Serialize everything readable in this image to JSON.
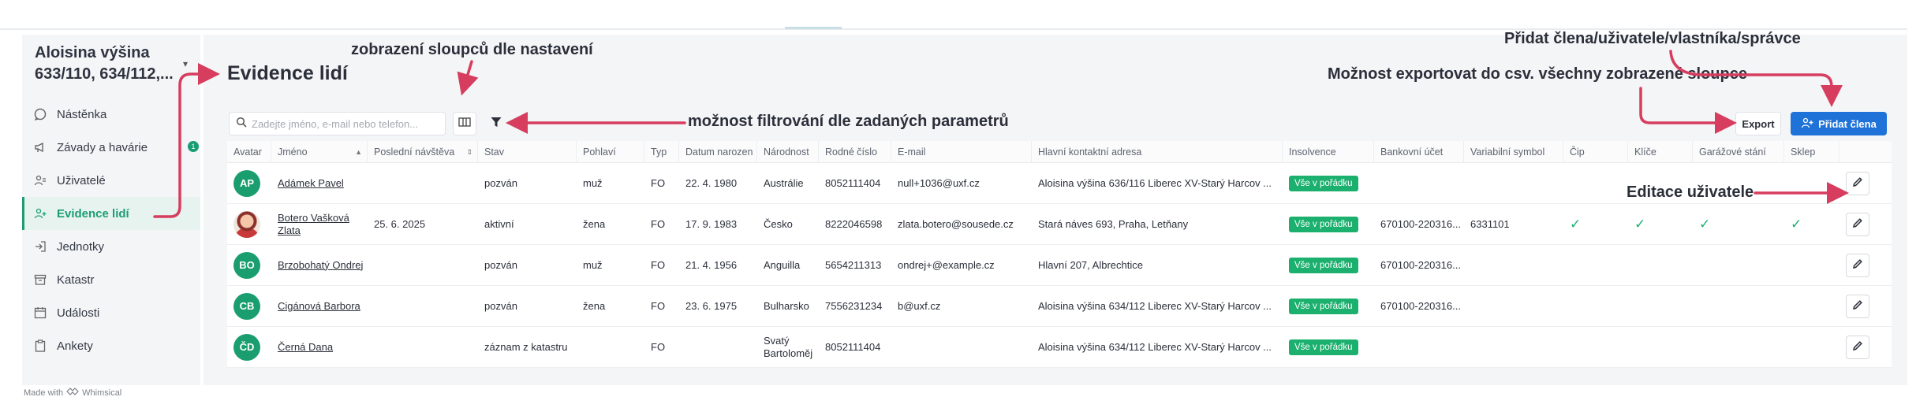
{
  "project": {
    "name": "Aloisina výšina 633/110, 634/112,...",
    "caret": "▾"
  },
  "sidebar": {
    "items": [
      {
        "label": "Nástěnka",
        "icon": "bubble-icon"
      },
      {
        "label": "Závady a havárie",
        "icon": "megaphone-icon",
        "badge": "1"
      },
      {
        "label": "Uživatelé",
        "icon": "users-icon"
      },
      {
        "label": "Evidence lidí",
        "icon": "person-add-icon",
        "active": true
      },
      {
        "label": "Jednotky",
        "icon": "door-enter-icon"
      },
      {
        "label": "Katastr",
        "icon": "archive-icon"
      },
      {
        "label": "Události",
        "icon": "calendar-icon"
      },
      {
        "label": "Ankety",
        "icon": "clipboard-icon"
      }
    ]
  },
  "main": {
    "title": "Evidence lidí",
    "search_placeholder": "Zadejte jméno, e-mail nebo telefon...",
    "export_label": "Export",
    "add_label": "Přidat člena"
  },
  "table": {
    "columns": [
      "Avatar",
      "Jméno",
      "Poslední návštěva",
      "Stav",
      "Pohlaví",
      "Typ",
      "Datum narozen",
      "Národnost",
      "Rodné číslo",
      "E-mail",
      "Hlavní kontaktní adresa",
      "Insolvence",
      "Bankovní účet",
      "Variabilní symbol",
      "Čip",
      "Klíče",
      "Garážové stání",
      "Sklep",
      ""
    ],
    "rows": [
      {
        "initials": "AP",
        "name": "Adámek Pavel",
        "last_visit": "",
        "status": "pozván",
        "gender": "muž",
        "type": "FO",
        "birth": "22. 4. 1980",
        "nationality": "Austrálie",
        "rc": "8052111404",
        "email": "null+1036@uxf.cz",
        "address": "Aloisina výšina 636/116 Liberec XV-Starý Harcov ...",
        "insolvency": "Vše v pořádku",
        "bank": "",
        "vs": "",
        "chip": "",
        "keys": "",
        "garage": "",
        "cellar": ""
      },
      {
        "initials": "",
        "photo": true,
        "name": "Botero Vašková Zlata",
        "last_visit": "25. 6. 2025",
        "status": "aktivní",
        "gender": "žena",
        "type": "FO",
        "birth": "17. 9. 1983",
        "nationality": "Česko",
        "rc": "8222046598",
        "email": "zlata.botero@sousede.cz",
        "address": "Stará náves 693, Praha, Letňany",
        "insolvency": "Vše v pořádku",
        "bank": "670100-220316...",
        "vs": "6331101",
        "chip": "✓",
        "keys": "✓",
        "garage": "✓",
        "cellar": "✓"
      },
      {
        "initials": "BO",
        "name": "Brzobohatý Ondrej",
        "last_visit": "",
        "status": "pozván",
        "gender": "muž",
        "type": "FO",
        "birth": "21. 4. 1956",
        "nationality": "Anguilla",
        "rc": "5654211313",
        "email": "ondrej+@example.cz",
        "address": "Hlavní 207, Albrechtice",
        "insolvency": "Vše v pořádku",
        "bank": "670100-220316...",
        "vs": "",
        "chip": "",
        "keys": "",
        "garage": "",
        "cellar": ""
      },
      {
        "initials": "CB",
        "name": "Cigánová Barbora",
        "last_visit": "",
        "status": "pozván",
        "gender": "žena",
        "type": "FO",
        "birth": "23. 6. 1975",
        "nationality": "Bulharsko",
        "rc": "7556231234",
        "email": "b@uxf.cz",
        "address": "Aloisina výšina 634/112 Liberec XV-Starý Harcov ...",
        "insolvency": "Vše v pořádku",
        "bank": "670100-220316...",
        "vs": "",
        "chip": "",
        "keys": "",
        "garage": "",
        "cellar": ""
      },
      {
        "initials": "ČD",
        "name": "Černá Dana",
        "last_visit": "",
        "status": "záznam z katastru",
        "gender": "",
        "type": "FO",
        "birth": "",
        "nationality": "Svatý Bartoloměj",
        "rc": "8052111404",
        "email": "",
        "address": "Aloisina výšina 634/112 Liberec XV-Starý Harcov ...",
        "insolvency": "Vše v pořádku",
        "bank": "",
        "vs": "",
        "chip": "",
        "keys": "",
        "garage": "",
        "cellar": ""
      }
    ]
  },
  "annotations": {
    "columns_note": "zobrazení sloupců dle nastavení",
    "filter_note": "možnost filtrování dle zadaných parametrů",
    "export_note": "Možnost exportovat do csv. všechny zobrazené sloupce",
    "add_note": "Přidat člena/uživatele/vlastníka/správce",
    "edit_note": "Editace uživatele"
  },
  "footer": {
    "made_with": "Made with",
    "brand": "Whimsical"
  },
  "colors": {
    "accent": "#1b9d74",
    "primary": "#1f72d8",
    "annotation_arrow": "#d63d5e",
    "ok_pill": "#1bb06e"
  }
}
